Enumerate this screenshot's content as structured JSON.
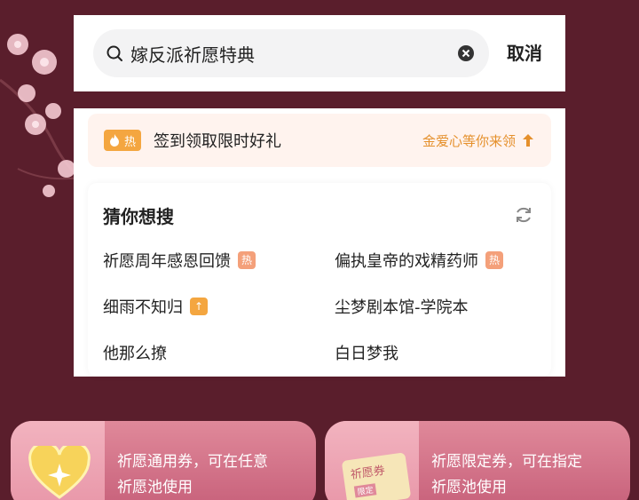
{
  "search": {
    "value": "嫁反派祈愿特典",
    "cancel_label": "取消"
  },
  "promo": {
    "badge": "热",
    "text": "签到领取限时好礼",
    "link": "金爱心等你来领"
  },
  "guess": {
    "title": "猜你想搜",
    "items": [
      {
        "label": "祈愿周年感恩回馈",
        "tag": "热"
      },
      {
        "label": "偏执皇帝的戏精药师",
        "tag": "热"
      },
      {
        "label": "细雨不知归",
        "tag": "↑"
      },
      {
        "label": "尘梦剧本馆-学院本",
        "tag": ""
      },
      {
        "label": "他那么撩",
        "tag": ""
      },
      {
        "label": "白日梦我",
        "tag": ""
      }
    ]
  },
  "coupons": [
    {
      "line1": "祈愿通用券，可在任意",
      "line2": "祈愿池使用"
    },
    {
      "line1": "祈愿限定券，可在指定",
      "line2": "祈愿池使用",
      "image_text": "祈愿券",
      "image_sub": "限定"
    }
  ],
  "colors": {
    "background": "#5a1e2c",
    "accent_orange": "#e5902c",
    "hot_tag": "#f4a07a",
    "coupon_pink": "#c7607a"
  },
  "icons": {
    "search": "search-icon",
    "clear": "clear-icon",
    "fire": "fire-icon",
    "refresh": "refresh-icon",
    "arrow_up": "arrow-up-icon",
    "heart": "heart-icon"
  }
}
